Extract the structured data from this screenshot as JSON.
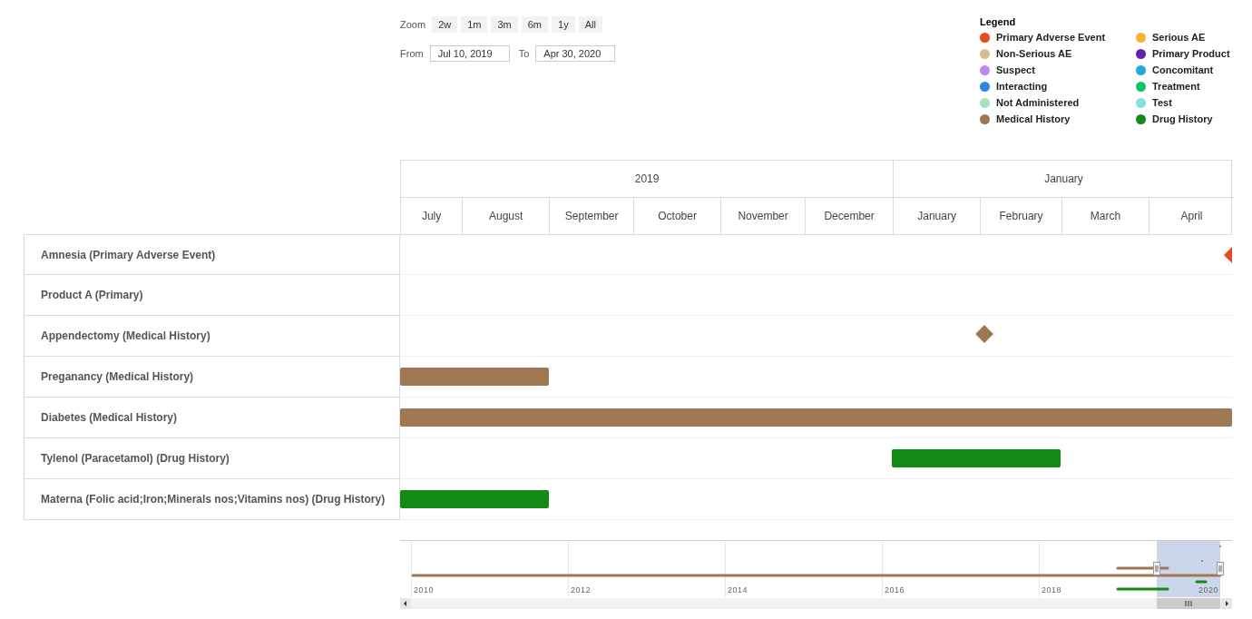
{
  "controls": {
    "zoom_label": "Zoom",
    "zoom_buttons": [
      {
        "label": "2w",
        "selected": false
      },
      {
        "label": "1m",
        "selected": false
      },
      {
        "label": "3m",
        "selected": false
      },
      {
        "label": "6m",
        "selected": false
      },
      {
        "label": "1y",
        "selected": false
      },
      {
        "label": "All",
        "selected": false
      }
    ],
    "from_label": "From",
    "from_value": "Jul 10, 2019",
    "to_label": "To",
    "to_value": "Apr 30, 2020"
  },
  "legend": {
    "title": "Legend",
    "items": [
      {
        "label": "Primary Adverse Event",
        "color": "#e8491d"
      },
      {
        "label": "Serious AE",
        "color": "#fbb12b"
      },
      {
        "label": "Non-Serious AE",
        "color": "#d5bd95"
      },
      {
        "label": "Primary Product",
        "color": "#6421b0"
      },
      {
        "label": "Suspect",
        "color": "#bb86f9"
      },
      {
        "label": "Concomitant",
        "color": "#21a9e0"
      },
      {
        "label": "Interacting",
        "color": "#2e86e6"
      },
      {
        "label": "Treatment",
        "color": "#0ec466"
      },
      {
        "label": "Not Administered",
        "color": "#a6e3b6"
      },
      {
        "label": "Test",
        "color": "#87e0de"
      },
      {
        "label": "Medical History",
        "color": "#a07753"
      },
      {
        "label": "Drug History",
        "color": "#138a13"
      }
    ]
  },
  "timeline": {
    "header_groups": [
      {
        "label": "2019",
        "months": [
          "July",
          "August",
          "September",
          "October",
          "November",
          "December"
        ]
      },
      {
        "label": "January",
        "months": [
          "January",
          "February",
          "March",
          "April"
        ]
      }
    ],
    "rows": [
      {
        "label": "Amnesia (Primary Adverse Event)",
        "kind": "offscreen-right",
        "color": "#e8491d"
      },
      {
        "label": "Product A (Primary)",
        "kind": "none"
      },
      {
        "label": "Appendectomy (Medical History)",
        "kind": "milestone",
        "color": "#a07753"
      },
      {
        "label": "Preganancy (Medical History)",
        "kind": "bar",
        "color": "#a07753"
      },
      {
        "label": "Diabetes (Medical History)",
        "kind": "bar",
        "color": "#a07753"
      },
      {
        "label": "Tylenol (Paracetamol) (Drug History)",
        "kind": "bar",
        "color": "#138a13"
      },
      {
        "label": "Materna (Folic acid;Iron;Minerals nos;Vitamins nos) (Drug History)",
        "kind": "bar",
        "color": "#138a13"
      }
    ]
  },
  "navigator": {
    "years": [
      "2010",
      "2012",
      "2014",
      "2016",
      "2018",
      "2020"
    ]
  }
}
